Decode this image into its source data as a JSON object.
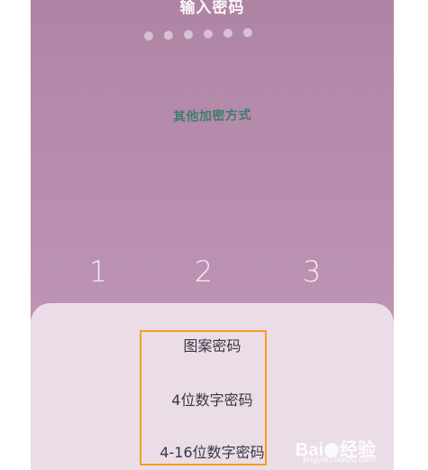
{
  "lockscreen": {
    "title": "输入密码",
    "dot_count": 6,
    "other_method_label": "其他加密方式",
    "keypad": [
      "1",
      "2",
      "3"
    ]
  },
  "sheet": {
    "options": [
      "图案密码",
      "4位数字密码",
      "4-16位数字密码"
    ]
  },
  "watermark": {
    "brand_left": "Bai",
    "brand_right": "经验",
    "domain": "jingyan.baidu.com"
  },
  "colors": {
    "background": "#b58bab",
    "sheet": "#eadde8",
    "accent_text": "#3f7e6a",
    "highlight_border": "#f2a01f"
  }
}
